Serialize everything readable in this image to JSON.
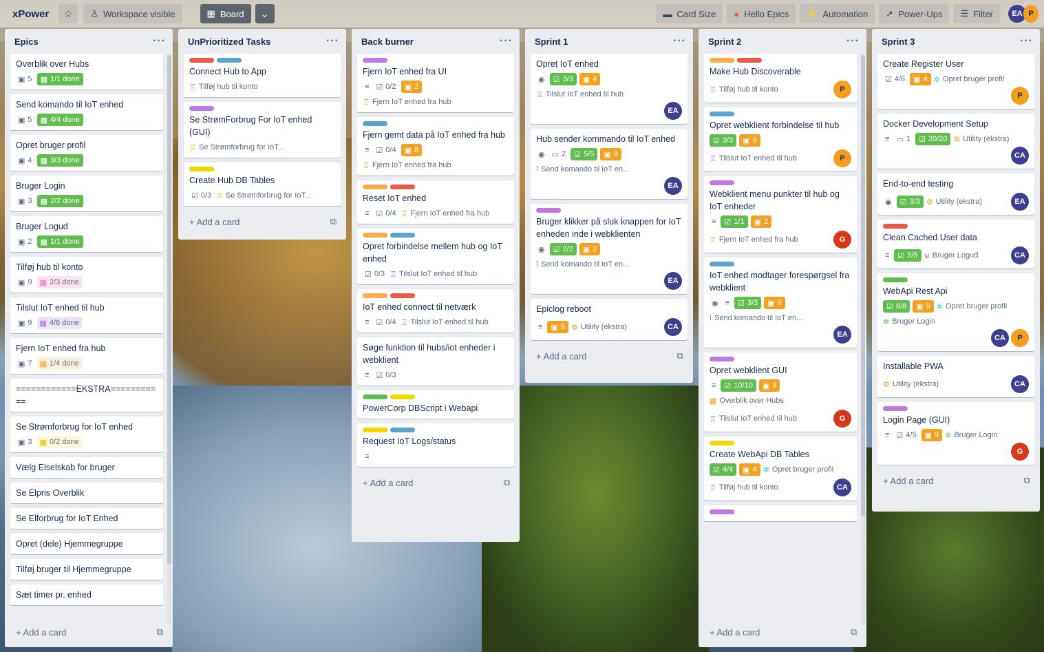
{
  "topbar": {
    "board_name": "xPower",
    "star_icon": "star-icon",
    "workspace_visible": "Workspace visible",
    "board_view": "Board",
    "card_size": "Card Size",
    "hello_epics": "Hello Epics",
    "automation": "Automation",
    "power_ups": "Power-Ups",
    "filter": "Filter",
    "members": [
      "EA",
      "P"
    ]
  },
  "add_card": "Add a card",
  "colors": {
    "green": "#61bd4f",
    "yellow": "#f2d600",
    "orange": "#ff9f1a",
    "red": "#eb5a46",
    "purple": "#c377e0",
    "blue": "#0079bf",
    "sky": "#5ba4cf",
    "avatar_ea": "#3f3f8f",
    "avatar_p": "#f39c1f",
    "avatar_g": "#d63a1c"
  },
  "lists": {
    "epics": {
      "title": "Epics",
      "cards": [
        {
          "title": "Overblik over Hubs",
          "count": "5",
          "done": "1/1 done"
        },
        {
          "title": "Send komando til IoT enhed",
          "count": "5",
          "done": "4/4 done"
        },
        {
          "title": "Opret bruger profil",
          "count": "4",
          "done": "3/3 done"
        },
        {
          "title": "Bruger Login",
          "count": "3",
          "done": "2/2 done"
        },
        {
          "title": "Bruger Logud",
          "count": "2",
          "done": "1/1 done"
        },
        {
          "title": "Tilføj hub til konto",
          "count": "9",
          "done": "2/3 done"
        },
        {
          "title": "Tilslut IoT enhed til hub",
          "count": "9",
          "done": "4/6 done"
        },
        {
          "title": "Fjern IoT enhed fra hub",
          "count": "7",
          "done": "1/4 done"
        },
        {
          "title": "============EKSTRA==========="
        },
        {
          "title": "Se Strømforbrug for IoT enhed",
          "count": "3",
          "done": "0/2 done"
        },
        {
          "title": "Vælg Elselskab for bruger"
        },
        {
          "title": "Se Elpris Overblik"
        },
        {
          "title": "Se Elforbrug for IoT Enhed"
        },
        {
          "title": "Opret (dele) Hjemmegruppe"
        },
        {
          "title": "Tilføj bruger til Hjemmegruppe"
        },
        {
          "title": "Sæt timer pr. enhed"
        }
      ]
    },
    "unprioritized": {
      "title": "UnPrioritized Tasks",
      "cards": [
        {
          "title": "Connect Hub to App",
          "rel": "Tilføj hub til konto"
        },
        {
          "title": "Se StrømForbrug For IoT enhed (GUI)",
          "rel": "Se Strømforbrug for IoT..."
        },
        {
          "title": "Create Hub DB Tables",
          "check": "0/3",
          "rel": "Se Strømforbrug for IoT..."
        }
      ]
    },
    "backburner": {
      "title": "Back burner",
      "cards": [
        {
          "title": "Fjern IoT enhed fra UI",
          "check": "0/2",
          "num": "2",
          "rel": "Fjern IoT enhed fra hub"
        },
        {
          "title": "Fjern gemt data på IoT enhed fra hub",
          "check": "0/4",
          "num": "8",
          "rel": "Fjern IoT enhed fra hub"
        },
        {
          "title": "Reset IoT enhed",
          "check": "0/4",
          "rel": "Fjern IoT enhed fra hub"
        },
        {
          "title": "Opret forbindelse mellem hub og IoT enhed",
          "check": "0/3",
          "rel": "Tilslut IoT enhed til hub"
        },
        {
          "title": "IoT enhed connect til netværk",
          "check": "0/4",
          "rel": "Tilslut IoT enhed til hub"
        },
        {
          "title": "Søge funktion til hubs/iot enheder i webklient",
          "check": "0/3"
        },
        {
          "title": "PowerCorp DBScript i Webapi"
        },
        {
          "title": "Request IoT Logs/status"
        }
      ]
    },
    "sprint1": {
      "title": "Sprint 1",
      "cards": [
        {
          "title": "Opret IoT enhed",
          "check": "3/3",
          "num": "4",
          "rel": "Tilslut IoT enhed til hub",
          "avatar": "EA"
        },
        {
          "title": "Hub sender kommando til IoT enhed",
          "comments": "2",
          "check": "5/5",
          "num": "9",
          "rel": "Send komando til IoT en...",
          "avatar": "EA"
        },
        {
          "title": "Bruger klikker på sluk knappen for IoT enheden inde i webklienten",
          "check": "2/2",
          "num": "2",
          "rel": "Send komando til IoT en...",
          "avatar": "EA"
        },
        {
          "title": "Epiclog reboot",
          "num": "9",
          "rel": "Utility (ekstra)",
          "avatar": "CA"
        }
      ]
    },
    "sprint2": {
      "title": "Sprint 2",
      "cards": [
        {
          "title": "Make Hub Discoverable",
          "rel": "Tilføj hub til konto",
          "avatar": "P"
        },
        {
          "title": "Opret webklient forbindelse til hub",
          "check": "3/3",
          "num": "9",
          "rel": "Tilslut IoT enhed til hub",
          "avatar": "P"
        },
        {
          "title": "Webklient menu punkter til hub og IoT enheder",
          "check": "1/1",
          "num": "2",
          "rel": "Fjern IoT enhed fra hub",
          "avatar": "G"
        },
        {
          "title": "IoT enhed modtager forespørgsel fra webklient",
          "check": "3/3",
          "num": "9",
          "rel": "Send komando til IoT en...",
          "avatar": "EA"
        },
        {
          "title": "Opret webklient GUI",
          "check": "10/10",
          "num": "9",
          "rel": "Overblik over Hubs",
          "rel2": "Tilslut IoT enhed til hub",
          "avatar": "G"
        },
        {
          "title": "Create WebApi DB Tables",
          "check": "4/4",
          "num": "4",
          "rel": "Opret bruger profil",
          "rel2": "Tilføj hub til konto",
          "avatar": "CA"
        }
      ]
    },
    "sprint3": {
      "title": "Sprint 3",
      "cards": [
        {
          "title": "Create Register User",
          "check": "4/6",
          "num": "4",
          "rel": "Opret bruger profil",
          "avatar": "P"
        },
        {
          "title": "Docker Development Setup",
          "comments": "1",
          "check": "20/20",
          "rel": "Utility (ekstra)",
          "avatar": "CA"
        },
        {
          "title": "End-to-end testing",
          "check": "3/3",
          "rel": "Utility (ekstra)",
          "avatar": "EA"
        },
        {
          "title": "Clean Cached User data",
          "check": "5/5",
          "rel": "Bruger Logud",
          "avatar": "CA"
        },
        {
          "title": "WebApi Rest Api",
          "check": "8/8",
          "num": "9",
          "rel": "Opret bruger profil",
          "rel2": "Bruger Login",
          "avatar": "CA",
          "avatar2": "P"
        },
        {
          "title": "Installable PWA",
          "rel": "Utility (ekstra)",
          "avatar": "CA"
        },
        {
          "title": "Login Page (GUI)",
          "check": "4/5",
          "num": "9",
          "rel": "Bruger Login",
          "avatar": "G"
        }
      ]
    }
  }
}
